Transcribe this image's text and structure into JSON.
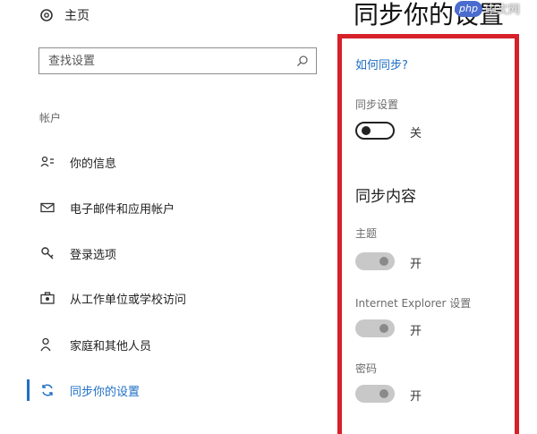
{
  "nav": {
    "home_label": "主页",
    "search_placeholder": "查找设置",
    "section_label": "帐户",
    "items": [
      {
        "label": "你的信息",
        "icon": "person-card-icon"
      },
      {
        "label": "电子邮件和应用帐户",
        "icon": "mail-icon"
      },
      {
        "label": "登录选项",
        "icon": "key-icon"
      },
      {
        "label": "从工作单位或学校访问",
        "icon": "briefcase-icon"
      },
      {
        "label": "家庭和其他人员",
        "icon": "people-icon"
      },
      {
        "label": "同步你的设置",
        "icon": "sync-icon",
        "active": true
      }
    ]
  },
  "main": {
    "title": "同步你的设置",
    "help_link": "如何同步?",
    "sync_settings": {
      "label": "同步设置",
      "state": "关",
      "on": false
    },
    "content_heading": "同步内容",
    "items": [
      {
        "label": "主题",
        "state": "开",
        "on": true
      },
      {
        "label": "Internet Explorer 设置",
        "state": "开",
        "on": true
      },
      {
        "label": "密码",
        "state": "开",
        "on": true
      }
    ]
  },
  "watermark": {
    "badge": "php",
    "text": "中文网"
  },
  "colors": {
    "accent": "#1f6fc5",
    "highlight_border": "#d6202a",
    "toggle_on_track": "#c8c8c8"
  }
}
